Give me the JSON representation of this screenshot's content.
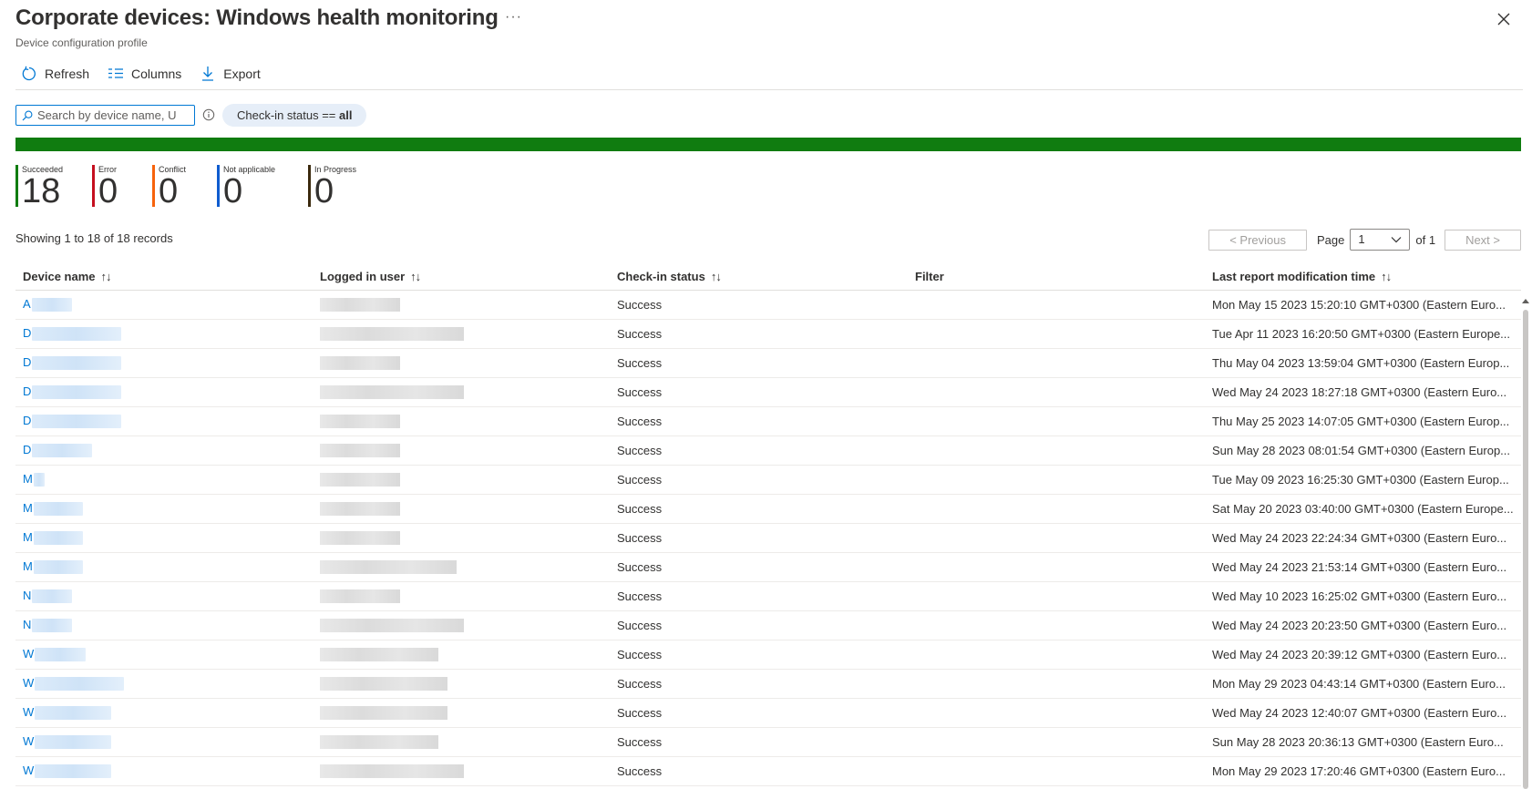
{
  "header": {
    "title": "Corporate devices: Windows health monitoring",
    "subtitle": "Device configuration profile",
    "more": "···"
  },
  "toolbar": {
    "refresh": "Refresh",
    "columns": "Columns",
    "export": "Export"
  },
  "search": {
    "placeholder": "Search by device name, U"
  },
  "filter_pill": {
    "prefix": "Check-in status == ",
    "value": "all"
  },
  "colors": {
    "succeeded": "#107c10",
    "error": "#c50f1f",
    "conflict": "#f7630c",
    "not_applicable": "#0f5ccf",
    "in_progress": "#3b2a0e",
    "accent": "#0078d4"
  },
  "stats": [
    {
      "label": "Succeeded",
      "value": "18"
    },
    {
      "label": "Error",
      "value": "0"
    },
    {
      "label": "Conflict",
      "value": "0"
    },
    {
      "label": "Not applicable",
      "value": "0"
    },
    {
      "label": "In Progress",
      "value": "0"
    }
  ],
  "records_text": "Showing 1 to 18 of 18 records",
  "pager": {
    "previous": "< Previous",
    "page_label": "Page",
    "page_value": "1",
    "of_label": "of 1",
    "next": "Next >"
  },
  "columns": [
    "Device name",
    "Logged in user",
    "Check-in status",
    "Filter",
    "Last report modification time"
  ],
  "rows": [
    {
      "device": "A",
      "status": "Success",
      "filter": "",
      "time": "Mon May 15 2023 15:20:10 GMT+0300 (Eastern Euro..."
    },
    {
      "device": "D",
      "status": "Success",
      "filter": "",
      "time": "Tue Apr 11 2023 16:20:50 GMT+0300 (Eastern Europe..."
    },
    {
      "device": "D",
      "status": "Success",
      "filter": "",
      "time": "Thu May 04 2023 13:59:04 GMT+0300 (Eastern Europ..."
    },
    {
      "device": "D",
      "status": "Success",
      "filter": "",
      "time": "Wed May 24 2023 18:27:18 GMT+0300 (Eastern Euro..."
    },
    {
      "device": "D",
      "status": "Success",
      "filter": "",
      "time": "Thu May 25 2023 14:07:05 GMT+0300 (Eastern Europ..."
    },
    {
      "device": "D",
      "status": "Success",
      "filter": "",
      "time": "Sun May 28 2023 08:01:54 GMT+0300 (Eastern Europ..."
    },
    {
      "device": "M",
      "status": "Success",
      "filter": "",
      "time": "Tue May 09 2023 16:25:30 GMT+0300 (Eastern Europ..."
    },
    {
      "device": "M",
      "status": "Success",
      "filter": "",
      "time": "Sat May 20 2023 03:40:00 GMT+0300 (Eastern Europe..."
    },
    {
      "device": "M",
      "status": "Success",
      "filter": "",
      "time": "Wed May 24 2023 22:24:34 GMT+0300 (Eastern Euro..."
    },
    {
      "device": "M",
      "status": "Success",
      "filter": "",
      "time": "Wed May 24 2023 21:53:14 GMT+0300 (Eastern Euro..."
    },
    {
      "device": "N",
      "status": "Success",
      "filter": "",
      "time": "Wed May 10 2023 16:25:02 GMT+0300 (Eastern Euro..."
    },
    {
      "device": "N",
      "status": "Success",
      "filter": "",
      "time": "Wed May 24 2023 20:23:50 GMT+0300 (Eastern Euro..."
    },
    {
      "device": "W",
      "status": "Success",
      "filter": "",
      "time": "Wed May 24 2023 20:39:12 GMT+0300 (Eastern Euro..."
    },
    {
      "device": "W",
      "status": "Success",
      "filter": "",
      "time": "Mon May 29 2023 04:43:14 GMT+0300 (Eastern Euro..."
    },
    {
      "device": "W",
      "status": "Success",
      "filter": "",
      "time": "Wed May 24 2023 12:40:07 GMT+0300 (Eastern Euro..."
    },
    {
      "device": "W",
      "status": "Success",
      "filter": "",
      "time": "Sun May 28 2023 20:36:13 GMT+0300 (Eastern Euro..."
    },
    {
      "device": "W",
      "status": "Success",
      "filter": "",
      "time": "Mon May 29 2023 17:20:46 GMT+0300 (Eastern Euro..."
    }
  ]
}
